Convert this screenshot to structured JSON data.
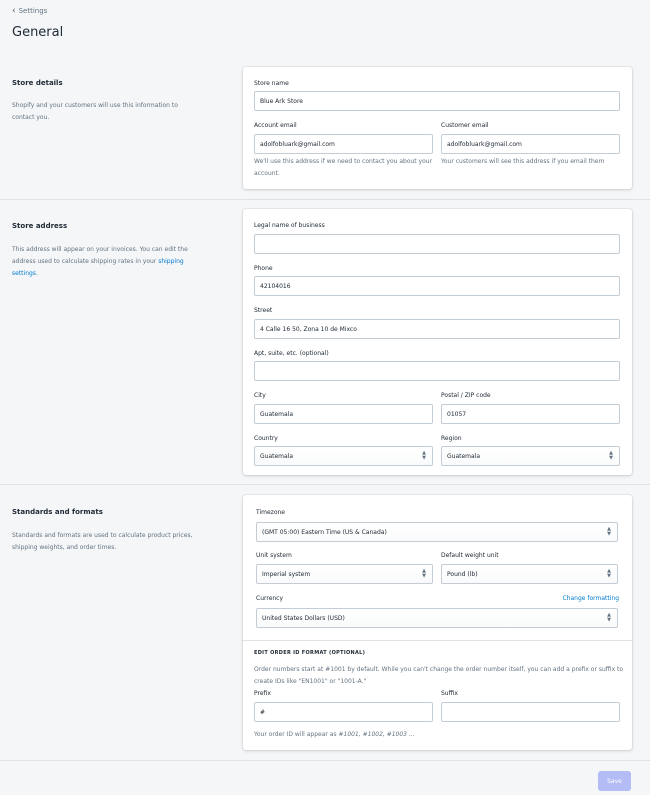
{
  "breadcrumb": {
    "label": "Settings"
  },
  "page_title": "General",
  "store_details": {
    "title": "Store details",
    "description": "Shopify and your customers will use this information to contact you.",
    "store_name_label": "Store name",
    "store_name_value": "Blue Ark Store",
    "account_email_label": "Account email",
    "account_email_value": "adolfobluark@gmail.com",
    "account_email_help": "We'll use this address if we need to contact you about your account.",
    "customer_email_label": "Customer email",
    "customer_email_value": "adolfobluark@gmail.com",
    "customer_email_help": "Your customers will see this address if you email them"
  },
  "store_address": {
    "title": "Store address",
    "description_before": "This address will appear on your invoices. You can edit the address used to calculate shipping rates in your ",
    "description_link": "shipping settings",
    "description_after": ".",
    "legal_name_label": "Legal name of business",
    "legal_name_value": "",
    "phone_label": "Phone",
    "phone_value": "42104016",
    "street_label": "Street",
    "street_value": "4 Calle 16 50, Zona 10 de Mixco",
    "apt_label": "Apt, suite, etc. (optional)",
    "apt_value": "",
    "city_label": "City",
    "city_value": "Guatemala",
    "postal_label": "Postal / ZIP code",
    "postal_value": "01057",
    "country_label": "Country",
    "country_value": "Guatemala",
    "region_label": "Region",
    "region_value": "Guatemala"
  },
  "standards": {
    "title": "Standards and formats",
    "description": "Standards and formats are used to calculate product prices, shipping weights, and order times.",
    "timezone_label": "Timezone",
    "timezone_value": "(GMT 05:00) Eastern Time (US & Canada)",
    "unit_system_label": "Unit system",
    "unit_system_value": "Imperial system",
    "weight_unit_label": "Default weight unit",
    "weight_unit_value": "Pound (lb)",
    "currency_label": "Currency",
    "change_formatting": "Change formatting",
    "currency_value": "United States Dollars (USD)",
    "order_id_title": "EDIT ORDER ID FORMAT (OPTIONAL)",
    "order_id_help": "Order numbers start at #1001 by default. While you can't change the order number itself, you can add a prefix or suffix to create IDs like \"EN1001\" or \"1001-A.\"",
    "prefix_label": "Prefix",
    "prefix_value": "#",
    "suffix_label": "Suffix",
    "suffix_value": "",
    "order_preview_before": "Your order ID will appear as ",
    "order_preview_examples": "#1001, #1002, #1003 ..."
  },
  "footer": {
    "save_label": "Save"
  },
  "colors": {
    "accent": "#007ace",
    "save_disabled": "#b3bcf5",
    "background": "#f4f6f8"
  }
}
